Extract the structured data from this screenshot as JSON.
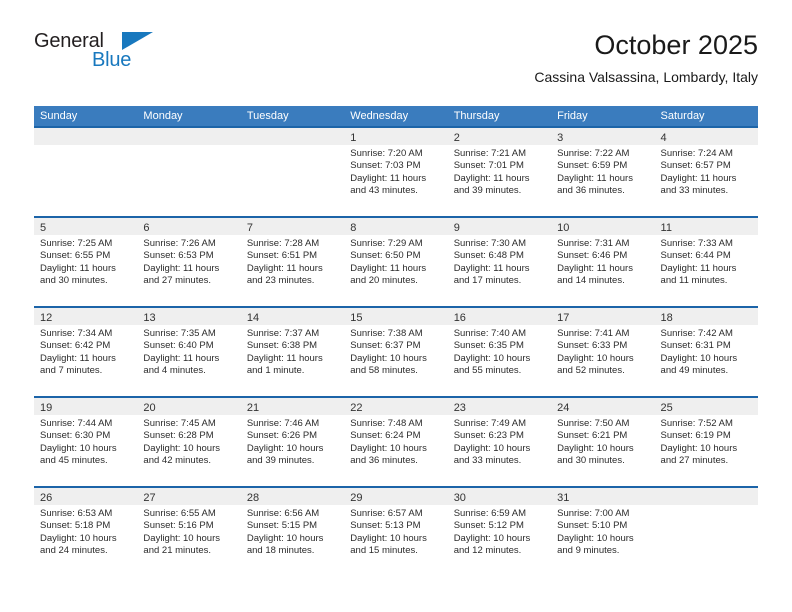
{
  "brand": {
    "line1": "General",
    "line2": "Blue",
    "triangle_color": "#1878be",
    "text_color": "#231f20"
  },
  "header": {
    "title": "October 2025",
    "subtitle": "Cassina Valsassina, Lombardy, Italy"
  },
  "colors": {
    "header_row_bg": "#3a7cbe",
    "header_row_text": "#ffffff",
    "cell_top_border": "#1c64a8",
    "daynum_band_bg": "#efefef",
    "body_text": "#2b2b2b"
  },
  "weekdays": [
    "Sunday",
    "Monday",
    "Tuesday",
    "Wednesday",
    "Thursday",
    "Friday",
    "Saturday"
  ],
  "weeks": [
    [
      {
        "day": "",
        "sunrise": "",
        "sunset": "",
        "daylight": ""
      },
      {
        "day": "",
        "sunrise": "",
        "sunset": "",
        "daylight": ""
      },
      {
        "day": "",
        "sunrise": "",
        "sunset": "",
        "daylight": ""
      },
      {
        "day": "1",
        "sunrise": "Sunrise: 7:20 AM",
        "sunset": "Sunset: 7:03 PM",
        "daylight": "Daylight: 11 hours and 43 minutes."
      },
      {
        "day": "2",
        "sunrise": "Sunrise: 7:21 AM",
        "sunset": "Sunset: 7:01 PM",
        "daylight": "Daylight: 11 hours and 39 minutes."
      },
      {
        "day": "3",
        "sunrise": "Sunrise: 7:22 AM",
        "sunset": "Sunset: 6:59 PM",
        "daylight": "Daylight: 11 hours and 36 minutes."
      },
      {
        "day": "4",
        "sunrise": "Sunrise: 7:24 AM",
        "sunset": "Sunset: 6:57 PM",
        "daylight": "Daylight: 11 hours and 33 minutes."
      }
    ],
    [
      {
        "day": "5",
        "sunrise": "Sunrise: 7:25 AM",
        "sunset": "Sunset: 6:55 PM",
        "daylight": "Daylight: 11 hours and 30 minutes."
      },
      {
        "day": "6",
        "sunrise": "Sunrise: 7:26 AM",
        "sunset": "Sunset: 6:53 PM",
        "daylight": "Daylight: 11 hours and 27 minutes."
      },
      {
        "day": "7",
        "sunrise": "Sunrise: 7:28 AM",
        "sunset": "Sunset: 6:51 PM",
        "daylight": "Daylight: 11 hours and 23 minutes."
      },
      {
        "day": "8",
        "sunrise": "Sunrise: 7:29 AM",
        "sunset": "Sunset: 6:50 PM",
        "daylight": "Daylight: 11 hours and 20 minutes."
      },
      {
        "day": "9",
        "sunrise": "Sunrise: 7:30 AM",
        "sunset": "Sunset: 6:48 PM",
        "daylight": "Daylight: 11 hours and 17 minutes."
      },
      {
        "day": "10",
        "sunrise": "Sunrise: 7:31 AM",
        "sunset": "Sunset: 6:46 PM",
        "daylight": "Daylight: 11 hours and 14 minutes."
      },
      {
        "day": "11",
        "sunrise": "Sunrise: 7:33 AM",
        "sunset": "Sunset: 6:44 PM",
        "daylight": "Daylight: 11 hours and 11 minutes."
      }
    ],
    [
      {
        "day": "12",
        "sunrise": "Sunrise: 7:34 AM",
        "sunset": "Sunset: 6:42 PM",
        "daylight": "Daylight: 11 hours and 7 minutes."
      },
      {
        "day": "13",
        "sunrise": "Sunrise: 7:35 AM",
        "sunset": "Sunset: 6:40 PM",
        "daylight": "Daylight: 11 hours and 4 minutes."
      },
      {
        "day": "14",
        "sunrise": "Sunrise: 7:37 AM",
        "sunset": "Sunset: 6:38 PM",
        "daylight": "Daylight: 11 hours and 1 minute."
      },
      {
        "day": "15",
        "sunrise": "Sunrise: 7:38 AM",
        "sunset": "Sunset: 6:37 PM",
        "daylight": "Daylight: 10 hours and 58 minutes."
      },
      {
        "day": "16",
        "sunrise": "Sunrise: 7:40 AM",
        "sunset": "Sunset: 6:35 PM",
        "daylight": "Daylight: 10 hours and 55 minutes."
      },
      {
        "day": "17",
        "sunrise": "Sunrise: 7:41 AM",
        "sunset": "Sunset: 6:33 PM",
        "daylight": "Daylight: 10 hours and 52 minutes."
      },
      {
        "day": "18",
        "sunrise": "Sunrise: 7:42 AM",
        "sunset": "Sunset: 6:31 PM",
        "daylight": "Daylight: 10 hours and 49 minutes."
      }
    ],
    [
      {
        "day": "19",
        "sunrise": "Sunrise: 7:44 AM",
        "sunset": "Sunset: 6:30 PM",
        "daylight": "Daylight: 10 hours and 45 minutes."
      },
      {
        "day": "20",
        "sunrise": "Sunrise: 7:45 AM",
        "sunset": "Sunset: 6:28 PM",
        "daylight": "Daylight: 10 hours and 42 minutes."
      },
      {
        "day": "21",
        "sunrise": "Sunrise: 7:46 AM",
        "sunset": "Sunset: 6:26 PM",
        "daylight": "Daylight: 10 hours and 39 minutes."
      },
      {
        "day": "22",
        "sunrise": "Sunrise: 7:48 AM",
        "sunset": "Sunset: 6:24 PM",
        "daylight": "Daylight: 10 hours and 36 minutes."
      },
      {
        "day": "23",
        "sunrise": "Sunrise: 7:49 AM",
        "sunset": "Sunset: 6:23 PM",
        "daylight": "Daylight: 10 hours and 33 minutes."
      },
      {
        "day": "24",
        "sunrise": "Sunrise: 7:50 AM",
        "sunset": "Sunset: 6:21 PM",
        "daylight": "Daylight: 10 hours and 30 minutes."
      },
      {
        "day": "25",
        "sunrise": "Sunrise: 7:52 AM",
        "sunset": "Sunset: 6:19 PM",
        "daylight": "Daylight: 10 hours and 27 minutes."
      }
    ],
    [
      {
        "day": "26",
        "sunrise": "Sunrise: 6:53 AM",
        "sunset": "Sunset: 5:18 PM",
        "daylight": "Daylight: 10 hours and 24 minutes."
      },
      {
        "day": "27",
        "sunrise": "Sunrise: 6:55 AM",
        "sunset": "Sunset: 5:16 PM",
        "daylight": "Daylight: 10 hours and 21 minutes."
      },
      {
        "day": "28",
        "sunrise": "Sunrise: 6:56 AM",
        "sunset": "Sunset: 5:15 PM",
        "daylight": "Daylight: 10 hours and 18 minutes."
      },
      {
        "day": "29",
        "sunrise": "Sunrise: 6:57 AM",
        "sunset": "Sunset: 5:13 PM",
        "daylight": "Daylight: 10 hours and 15 minutes."
      },
      {
        "day": "30",
        "sunrise": "Sunrise: 6:59 AM",
        "sunset": "Sunset: 5:12 PM",
        "daylight": "Daylight: 10 hours and 12 minutes."
      },
      {
        "day": "31",
        "sunrise": "Sunrise: 7:00 AM",
        "sunset": "Sunset: 5:10 PM",
        "daylight": "Daylight: 10 hours and 9 minutes."
      },
      {
        "day": "",
        "sunrise": "",
        "sunset": "",
        "daylight": ""
      }
    ]
  ]
}
